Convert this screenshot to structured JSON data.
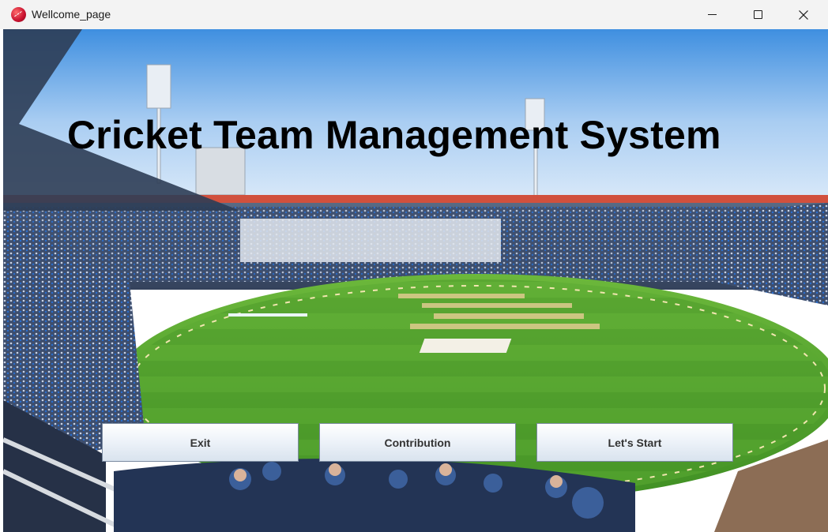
{
  "window": {
    "title": "Wellcome_page",
    "app_icon": "cricket-ball-icon",
    "controls": [
      "minimize-icon",
      "maximize-icon",
      "close-icon"
    ]
  },
  "main": {
    "heading": "Cricket Team Management System",
    "background": "cricket stadium photograph",
    "buttons": {
      "exit": "Exit",
      "contribution": "Contribution",
      "start": "Let's Start"
    }
  },
  "colors": {
    "pitch_green": "#4f9e2d",
    "sky": "#e8f1fb",
    "button_border": "#7a8aa0"
  }
}
